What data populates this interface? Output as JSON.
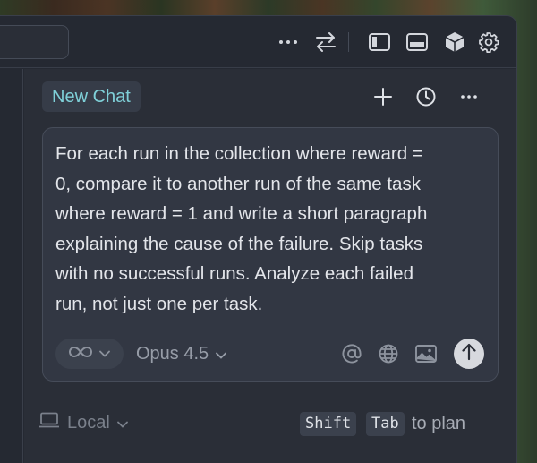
{
  "header": {
    "icons": [
      "more-icon",
      "swap-icon",
      "sidebar-left-icon",
      "panel-bottom-icon",
      "cube-icon",
      "gear-icon"
    ]
  },
  "panel": {
    "tab_label": "New Chat",
    "header_icons": [
      "plus-icon",
      "history-icon",
      "more-icon"
    ]
  },
  "composer": {
    "prompt_lines": [
      "For each run in the collection where reward =",
      "0, compare it to another run of the same task",
      "where reward = 1 and write a short paragraph",
      "explaining the cause of the failure. Skip tasks",
      "with no successful runs. Analyze each failed",
      "run, not just one per task."
    ],
    "mode_icon": "infinity-icon",
    "model_label": "Opus 4.5",
    "toolbar_icons": [
      "at-icon",
      "globe-icon",
      "image-icon"
    ],
    "send_icon": "arrow-up-icon"
  },
  "footer": {
    "env_label": "Local",
    "shortcut_keys": [
      "Shift",
      "Tab"
    ],
    "shortcut_hint": "to plan"
  }
}
